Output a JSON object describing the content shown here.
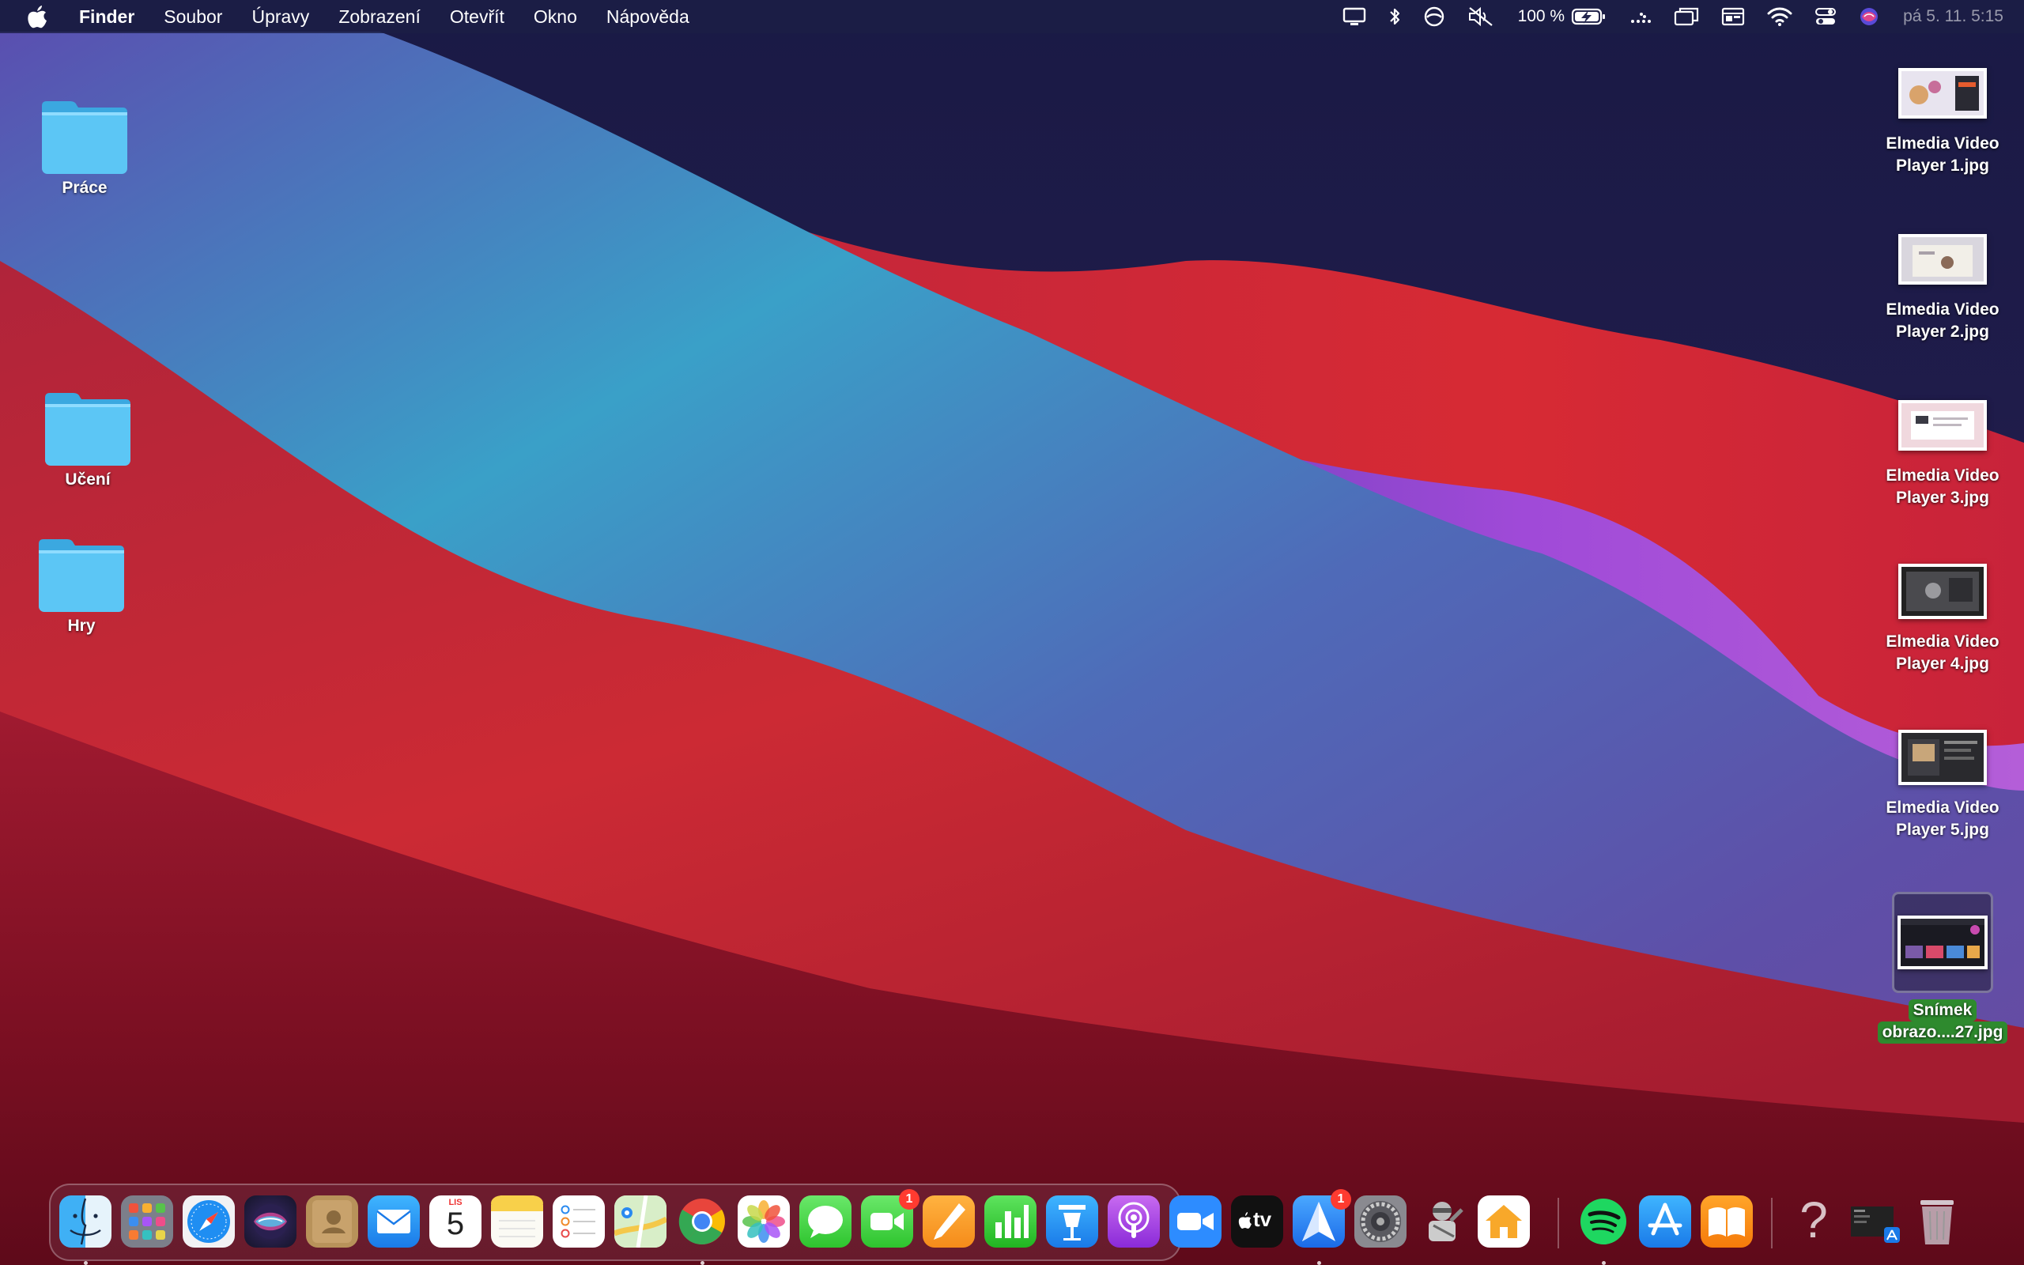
{
  "menubar": {
    "app_name": "Finder",
    "items": [
      "Soubor",
      "Úpravy",
      "Zobrazení",
      "Otevřít",
      "Okno",
      "Nápověda"
    ],
    "battery_text": "100 %",
    "clock": "pá 5. 11. 5:15"
  },
  "desktop_left": [
    {
      "label": "Práce"
    },
    {
      "label": "Učení"
    },
    {
      "label": "Hry"
    }
  ],
  "desktop_right": [
    {
      "line1": "Elmedia Video",
      "line2": "Player 1.jpg"
    },
    {
      "line1": "Elmedia Video",
      "line2": "Player 2.jpg"
    },
    {
      "line1": "Elmedia Video",
      "line2": "Player 3.jpg"
    },
    {
      "line1": "Elmedia Video",
      "line2": "Player 4.jpg"
    },
    {
      "line1": "Elmedia Video",
      "line2": "Player 5.jpg"
    }
  ],
  "selected_file": {
    "line1": "Snímek",
    "line2": "obrazo....27.jpg"
  },
  "dock": {
    "apps": [
      "Finder",
      "Launchpad",
      "Safari",
      "Siri",
      "Kontakty",
      "Mail",
      "Kalendář",
      "Poznámky",
      "Připomínky",
      "Mapy",
      "Google Chrome",
      "Fotky",
      "Zprávy",
      "FaceTime",
      "Pages",
      "Numbers",
      "Keynote",
      "Podcasty",
      "Zoom",
      "TV",
      "Spark",
      "Předvolby systému",
      "Automator",
      "Domácnost",
      "Spotify",
      "App Store",
      "Knihy",
      "Nápověda",
      "Stažené",
      "Koš"
    ],
    "calendar_month": "LIS",
    "calendar_day": "5",
    "facetime_badge": "1",
    "spark_badge": "1",
    "help_glyph": "?",
    "tv_label": "tv"
  },
  "colors": {
    "menubar": "#1c1e46",
    "folder": "#5cc6f5",
    "selection_label": "#2e8a2e",
    "badge": "#ff3b30"
  }
}
